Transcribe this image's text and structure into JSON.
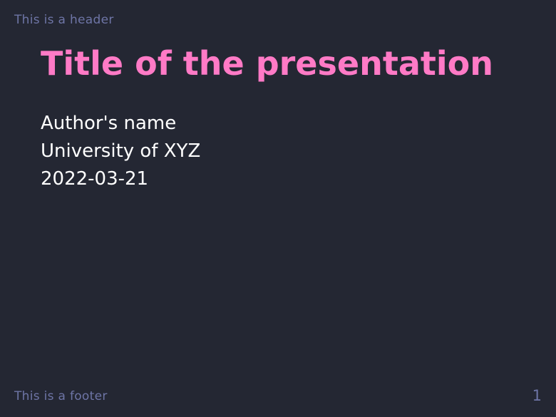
{
  "slide": {
    "header": "This is a header",
    "title": "Title of the presentation",
    "author": "Author's name",
    "institution": "University of XYZ",
    "date": "2022-03-21",
    "footer": "This is a footer",
    "page_number": "1"
  },
  "colors": {
    "background": "#242733",
    "title": "#ff7ac6",
    "text": "#ffffff",
    "muted": "#6e75a6"
  }
}
